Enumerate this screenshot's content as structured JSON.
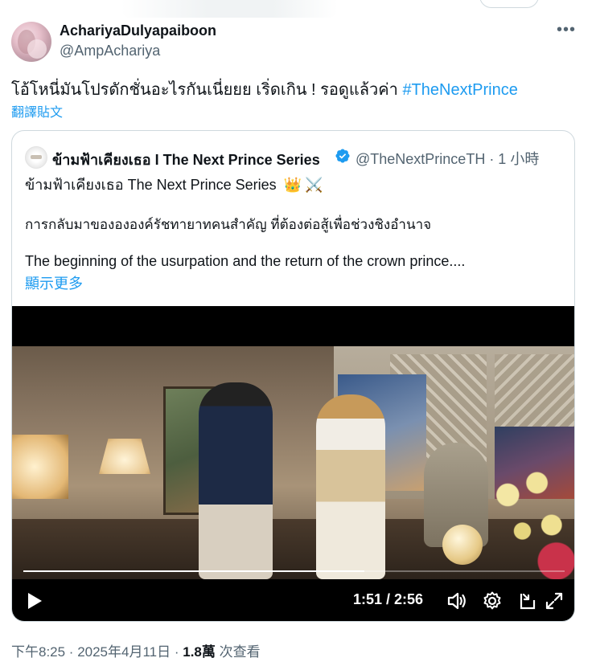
{
  "author": {
    "display_name": "AchariyaDulyapaiboon",
    "handle": "@AmpAchariya"
  },
  "tweet": {
    "text": "โอ้โหนี่มันโปรดักชั่นอะไรกันเนี่ยยย เริ่ดเกิน ! รอดูแล้วค่า ",
    "hashtag": "#TheNextPrince",
    "translate_label": "翻譯貼文",
    "more_icon": "more-icon"
  },
  "quoted": {
    "display_name": "ข้ามฟ้าเคียงเธอ I The Next Prince Series",
    "handle_time": "@TheNextPrinceTH · 1 小時",
    "line1": "ข้ามฟ้าเคียงเธอ The Next Prince Series",
    "emoji1": "👑",
    "emoji2": "⚔️",
    "line2": "การกลับมาของององค์รัชทายาทคนสำคัญ ที่ต้องต่อสู้เพื่อช่วงชิงอำนาจ",
    "line3": "The beginning of the usurpation and the return of the crown prince....",
    "show_more": "顯示更多"
  },
  "video": {
    "time": "1:51 / 2:56",
    "progress": 0.63
  },
  "footer": {
    "time_date": "下午8:25 · 2025年4月11日 · ",
    "views": "1.8萬",
    "views_label": " 次查看"
  }
}
